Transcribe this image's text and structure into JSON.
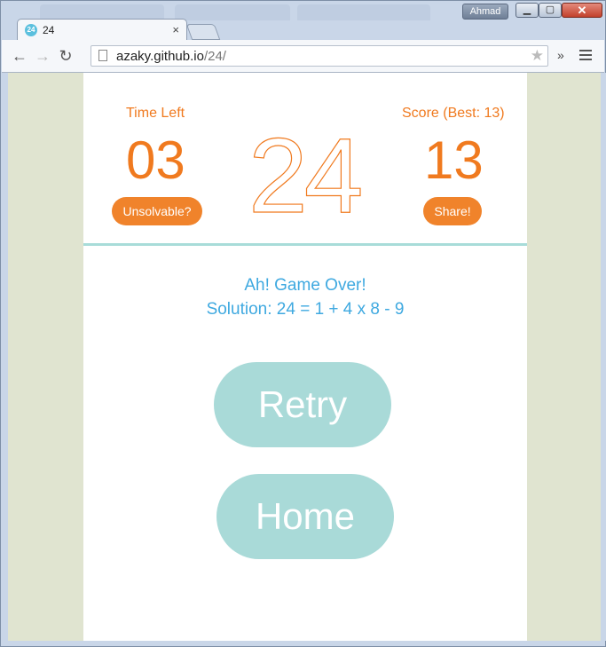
{
  "window": {
    "user": "Ahmad"
  },
  "tab": {
    "favicon_text": "24",
    "title": "24",
    "close_glyph": "×"
  },
  "toolbar": {
    "url_host": "azaky.github.io",
    "url_path": "/24/",
    "extensions_glyph": "»"
  },
  "game": {
    "time_label": "Time Left",
    "time_value": "03",
    "target": "24",
    "score_label": "Score (Best: 13)",
    "score_value": "13",
    "unsolvable_label": "Unsolvable?",
    "share_label": "Share!",
    "game_over": "Ah! Game Over!",
    "solution": "Solution: 24 = 1 + 4 x 8 - 9",
    "retry_label": "Retry",
    "home_label": "Home"
  },
  "colors": {
    "accent_orange": "#f07a1f",
    "button_teal": "#a9dad8",
    "message_blue": "#3fa9e0",
    "page_bg": "#e0e4d0"
  }
}
